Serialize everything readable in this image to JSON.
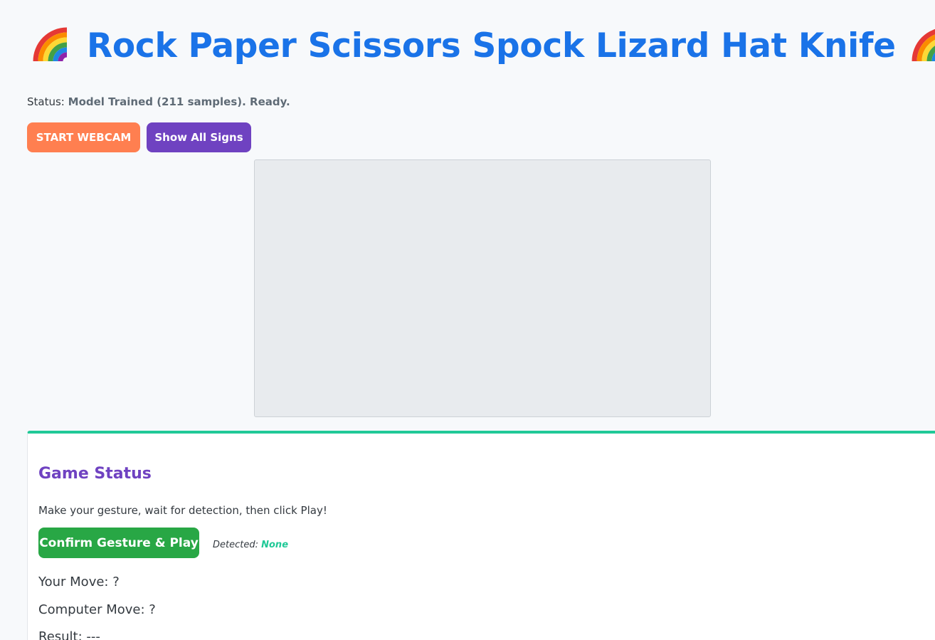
{
  "header": {
    "title": "Rock Paper Scissors Spock Lizard Hat Knife",
    "left_icon": "rainbow-icon",
    "right_icon": "rainbow-icon"
  },
  "status": {
    "label": "Status:",
    "value": "Model Trained (211 samples). Ready."
  },
  "toolbar": {
    "webcam_label": "START WEBCAM",
    "signs_label": "Show All Signs"
  },
  "game": {
    "title": "Game Status",
    "instructions": "Make your gesture, wait for detection, then click Play!",
    "play_label": "Confirm Gesture & Play",
    "detected_label": "Detected:",
    "detected_value": "None",
    "your_move": "Your Move: ?",
    "computer_move": "Computer Move: ?",
    "result": "Result: ---"
  },
  "colors": {
    "title": "#1a73e8",
    "webcam_button": "#ff7f50",
    "signs_button": "#6f42c1",
    "play_button": "#28a745",
    "accent": "#20c997",
    "game_title": "#6f42c1"
  }
}
